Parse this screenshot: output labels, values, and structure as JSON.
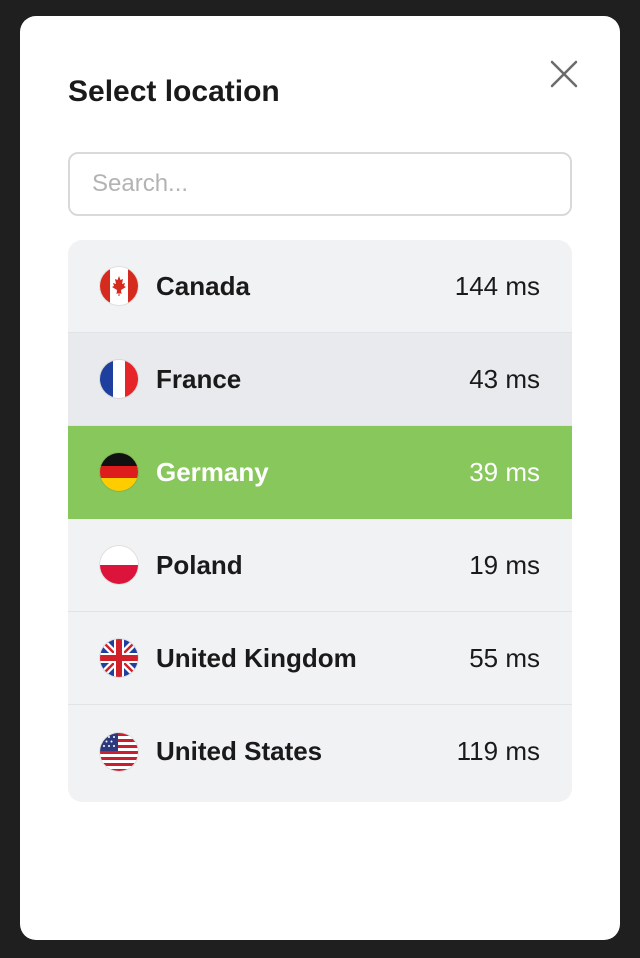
{
  "modal": {
    "title": "Select location",
    "close_icon": "close-icon"
  },
  "search": {
    "placeholder": "Search...",
    "value": ""
  },
  "locations": [
    {
      "country": "Canada",
      "latency": "144 ms",
      "flag": "canada-flag-icon",
      "state": "normal"
    },
    {
      "country": "France",
      "latency": "43 ms",
      "flag": "france-flag-icon",
      "state": "hovered"
    },
    {
      "country": "Germany",
      "latency": "39 ms",
      "flag": "germany-flag-icon",
      "state": "selected"
    },
    {
      "country": "Poland",
      "latency": "19 ms",
      "flag": "poland-flag-icon",
      "state": "normal"
    },
    {
      "country": "United Kingdom",
      "latency": "55 ms",
      "flag": "uk-flag-icon",
      "state": "normal"
    },
    {
      "country": "United States",
      "latency": "119 ms",
      "flag": "us-flag-icon",
      "state": "normal"
    }
  ],
  "colors": {
    "selected": "#88c75b",
    "list_background": "#f1f2f4",
    "backdrop": "#1f1f1f"
  }
}
